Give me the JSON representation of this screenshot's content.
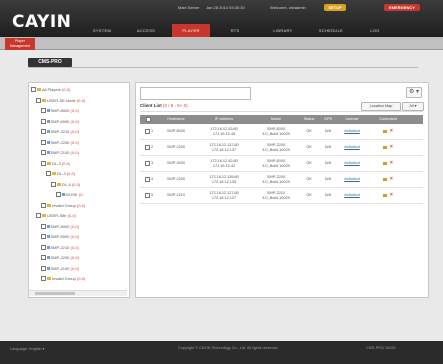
{
  "app": {
    "logo": "CAYIN"
  },
  "status": {
    "server": "Main Server",
    "datetime": "Jan 28 2014 03:30:30",
    "welcome": "Welcome, winadmin",
    "setup_label": "SETUP",
    "emergency_label": "EMERGENCY"
  },
  "nav": {
    "tabs": [
      "SYSTEM",
      "ACCESS",
      "PLAYER",
      "RTS",
      "LIBRARY",
      "SCHEDULE",
      "LOG"
    ],
    "active": "PLAYER"
  },
  "subnav": {
    "item_line1": "Player",
    "item_line2": "Management"
  },
  "page": {
    "title": "CMS-PRO"
  },
  "tree": {
    "items": [
      {
        "label": "All Players",
        "count": "(0-0)",
        "indent": 0,
        "kind": "root"
      },
      {
        "label": "USER-SE-Node",
        "count": "(0-0)",
        "indent": 1,
        "kind": "folder"
      },
      {
        "label": "SMP-8000",
        "count": "(0-0)",
        "indent": 2,
        "kind": "player"
      },
      {
        "label": "SMP-6000",
        "count": "(0-0)",
        "indent": 2,
        "kind": "player"
      },
      {
        "label": "SMP-2210",
        "count": "(0-0)",
        "indent": 2,
        "kind": "player"
      },
      {
        "label": "SMP-2200",
        "count": "(0-0)",
        "indent": 2,
        "kind": "player"
      },
      {
        "label": "SMP-2100",
        "count": "(0-0)",
        "indent": 2,
        "kind": "player"
      },
      {
        "label": "DL-3",
        "count": "(0-0)",
        "indent": 2,
        "kind": "folder"
      },
      {
        "label": "DL-3",
        "count": "(0-0)",
        "indent": 3,
        "kind": "folder"
      },
      {
        "label": "DL-4",
        "count": "(0-0)",
        "indent": 4,
        "kind": "folder"
      },
      {
        "label": "KIOSK",
        "count": "(0-",
        "indent": 5,
        "kind": "player"
      },
      {
        "label": "Invalid Group",
        "count": "(0-0)",
        "indent": 2,
        "kind": "folder"
      },
      {
        "label": "USER-Site",
        "count": "(0-0)",
        "indent": 1,
        "kind": "folder"
      },
      {
        "label": "SMP-8000",
        "count": "(0-0)",
        "indent": 2,
        "kind": "player"
      },
      {
        "label": "SMP-6000",
        "count": "(0-0)",
        "indent": 2,
        "kind": "player"
      },
      {
        "label": "SMP-2210",
        "count": "(0-0)",
        "indent": 2,
        "kind": "player"
      },
      {
        "label": "SMP-2200",
        "count": "(0-0)",
        "indent": 2,
        "kind": "player"
      },
      {
        "label": "SMP-2100",
        "count": "(0-0)",
        "indent": 2,
        "kind": "player"
      },
      {
        "label": "Invalid Group",
        "count": "(0-0)",
        "indent": 2,
        "kind": "folder"
      }
    ]
  },
  "content": {
    "search_placeholder": "",
    "gear_label": "⚙ ▾",
    "client_title": "Client List",
    "client_count": "(0 / 5 - 5+ 0)",
    "location_map_label": "Location Map",
    "all_label": "All ▾",
    "columns": [
      "",
      "Hostname",
      "IP Address",
      "Model",
      "Status",
      "GPS",
      "License",
      "Command"
    ],
    "rows": [
      {
        "index": "1",
        "hostname": "SMP-8000",
        "ip1": "172.16.12.43:80",
        "ip2": "172.16.12.45",
        "model1": "SMP-8000",
        "model2": "3.0_Build 10025",
        "status": "OK",
        "gps": "N/A",
        "license": "Activated"
      },
      {
        "index": "2",
        "hostname": "SMP-2200",
        "ip1": "172.16.12.137:80",
        "ip2": "172.16.12.137",
        "model1": "SMP-2200",
        "model2": "3.0_Build 10025",
        "status": "OK",
        "gps": "N/A",
        "license": "Activated"
      },
      {
        "index": "3",
        "hostname": "SMP-3000",
        "ip1": "172.16.12.42:80",
        "ip2": "172.16.12.42",
        "model1": "SMP-6000",
        "model2": "3.0_Build 10025",
        "status": "OK",
        "gps": "N/A",
        "license": "Activated"
      },
      {
        "index": "4",
        "hostname": "SMP-2200",
        "ip1": "172.16.12.135:80",
        "ip2": "172.16.12.135",
        "model1": "SMP-2200",
        "model2": "3.0_Build 10025",
        "status": "OK",
        "gps": "N/A",
        "license": "Activated"
      },
      {
        "index": "5",
        "hostname": "SMP-2210",
        "ip1": "172.16.12.127:80",
        "ip2": "172.16.12.127",
        "model1": "SMP-2210",
        "model2": "3.0_Build 10025",
        "status": "OK",
        "gps": "N/A",
        "license": "Activated"
      }
    ]
  },
  "footer": {
    "language": "Language:  English  ▾",
    "copyright": "Copyright © CAYIN Technology Co., Ltd. All rights reserved.",
    "version": "CMS-PRO 10025"
  },
  "colors": {
    "accent": "#c8372d",
    "setup": "#d9a21b",
    "emergency": "#c8372d"
  }
}
